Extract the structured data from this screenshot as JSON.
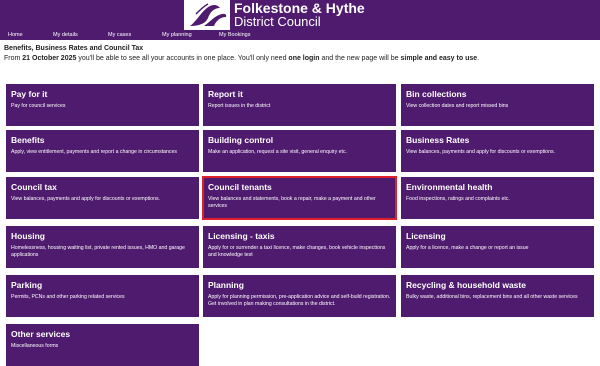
{
  "brand": {
    "line1": "Folkestone & Hythe",
    "line2": "District Council"
  },
  "nav": [
    {
      "label": "Home"
    },
    {
      "label": "My details"
    },
    {
      "label": "My cases"
    },
    {
      "label": "My planning"
    },
    {
      "label": "My Bookings"
    }
  ],
  "notice": {
    "title": "Benefits, Business Rates and Council Tax",
    "prefix": "From ",
    "date": "21 October 2025",
    "mid1": " you'll be able to see all your accounts in one place. You'll only need ",
    "login": "one login",
    "mid2": " and the new page will be ",
    "simple": "simple and easy to use",
    "end": "."
  },
  "colors": {
    "brand_purple": "#4f1b6e",
    "highlight_red": "#e0202a"
  },
  "services": [
    {
      "title": "Pay for it",
      "desc": "Pay for council services"
    },
    {
      "title": "Report it",
      "desc": "Report issues in the district"
    },
    {
      "title": "Bin collections",
      "desc": "View collection dates and report missed bins"
    },
    {
      "title": "Benefits",
      "desc": "Apply, view entitlement, payments and report a change in circumstances"
    },
    {
      "title": "Building control",
      "desc": "Make an application, request a site visit, general enquiry etc."
    },
    {
      "title": "Business Rates",
      "desc": "View balances, payments and apply for discounts or exemptions."
    },
    {
      "title": "Council tax",
      "desc": "View balances, payments and apply for discounts or exemptions."
    },
    {
      "title": "Council tenants",
      "desc": "View balances and statements, book a repair, make a payment and other services"
    },
    {
      "title": "Environmental health",
      "desc": "Food inspections, ratings and complaints etc."
    },
    {
      "title": "Housing",
      "desc": "Homelessness, housing waiting list, private rented issues, HMO and garage applications"
    },
    {
      "title": "Licensing - taxis",
      "desc": "Apply for or surrender a taxi licence, make changes, book vehicle inspections and knowledge test"
    },
    {
      "title": "Licensing",
      "desc": "Apply for a licence, make a change or report an issue"
    },
    {
      "title": "Parking",
      "desc": "Permits, PCNs and other parking related services"
    },
    {
      "title": "Planning",
      "desc": "Apply for planning permission, pre-application advice and self-build registration. Get involved in plan making consultations in the district."
    },
    {
      "title": "Recycling & household waste",
      "desc": "Bulky waste, additional bins, replacement bins and all other waste services"
    },
    {
      "title": "Other services",
      "desc": "Miscellaneous forms"
    }
  ]
}
